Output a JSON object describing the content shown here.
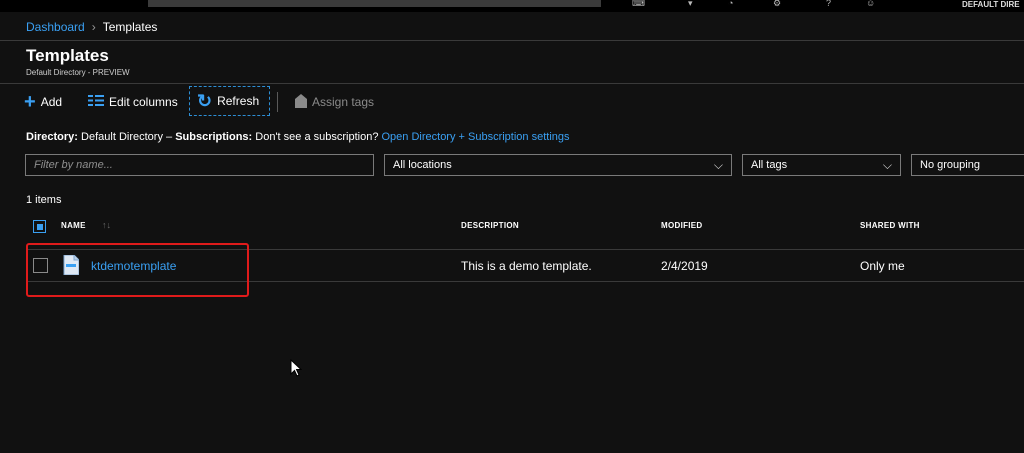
{
  "topbar": {
    "directory": "DEFAULT DIRE"
  },
  "breadcrumb": {
    "home": "Dashboard",
    "separator": "›",
    "current": "Templates"
  },
  "page": {
    "title": "Templates",
    "subtitle": "Default Directory - PREVIEW"
  },
  "toolbar": {
    "add": "Add",
    "edit_columns": "Edit columns",
    "refresh": "Refresh",
    "assign_tags": "Assign tags"
  },
  "directory_line": {
    "dir_label": "Directory:",
    "dir_value": "Default Directory –",
    "sub_label": "Subscriptions:",
    "sub_value": "Don't see a subscription?",
    "link": "Open Directory + Subscription settings"
  },
  "filters": {
    "name_placeholder": "Filter by name...",
    "locations": "All locations",
    "tags": "All tags",
    "grouping": "No grouping"
  },
  "item_count": "1 items",
  "table": {
    "headers": {
      "name": "NAME",
      "description": "DESCRIPTION",
      "modified": "MODIFIED",
      "shared_with": "SHARED WITH"
    },
    "rows": [
      {
        "name": "ktdemotemplate",
        "description": "This is a demo template.",
        "modified": "2/4/2019",
        "shared_with": "Only me"
      }
    ]
  },
  "colors": {
    "accent": "#3aa0f3",
    "background": "#111111",
    "highlight_box": "#e01b1b"
  }
}
